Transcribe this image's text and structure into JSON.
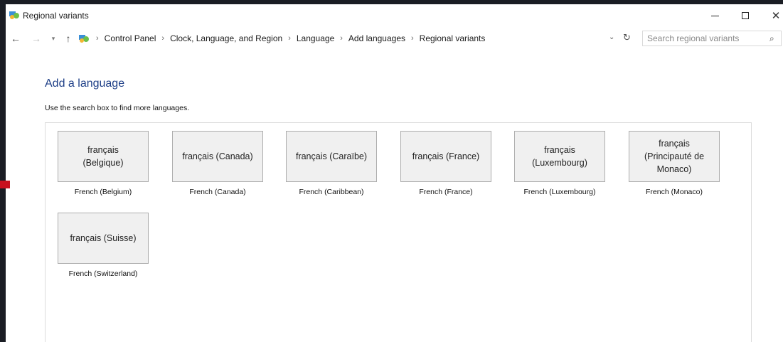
{
  "window": {
    "title": "Regional variants",
    "controls": {
      "minimize": "—",
      "maximize": "☐",
      "close": "✕"
    }
  },
  "navigation": {
    "breadcrumbs": [
      "Control Panel",
      "Clock, Language, and Region",
      "Language",
      "Add languages",
      "Regional variants"
    ],
    "search_placeholder": "Search regional variants"
  },
  "content": {
    "heading": "Add a language",
    "instruction": "Use the search box to find more languages.",
    "tiles": [
      {
        "native": "français\n(Belgique)",
        "english": "French (Belgium)"
      },
      {
        "native": "français (Canada)",
        "english": "French (Canada)"
      },
      {
        "native": "français (Caraïbe)",
        "english": "French (Caribbean)"
      },
      {
        "native": "français (France)",
        "english": "French (France)"
      },
      {
        "native": "français\n(Luxembourg)",
        "english": "French (Luxembourg)"
      },
      {
        "native": "français\n(Principauté de\nMonaco)",
        "english": "French (Monaco)"
      },
      {
        "native": "français (Suisse)",
        "english": "French (Switzerland)"
      }
    ]
  }
}
